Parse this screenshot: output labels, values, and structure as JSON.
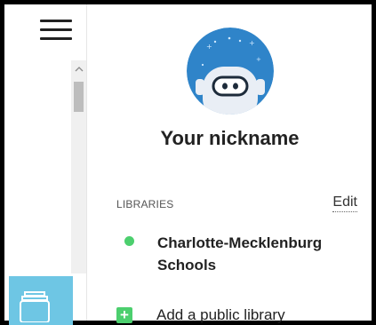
{
  "menu": {
    "icon": "hamburger-icon"
  },
  "scrollbar": {
    "up_icon": "chevron-up-icon"
  },
  "profile": {
    "nickname": "Your nickname",
    "avatar_icon": "robot-avatar-icon"
  },
  "libraries": {
    "heading": "LIBRARIES",
    "edit_label": "Edit",
    "items": [
      {
        "name": "Charlotte-Mecklenburg Schools",
        "status_color": "#4ccf6e"
      }
    ],
    "add_label": "Add a public library",
    "add_icon": "plus-icon"
  },
  "colors": {
    "accent_green": "#4ccf6e",
    "tile_blue": "#6ec6e4",
    "avatar_blue": "#2f84c9"
  }
}
